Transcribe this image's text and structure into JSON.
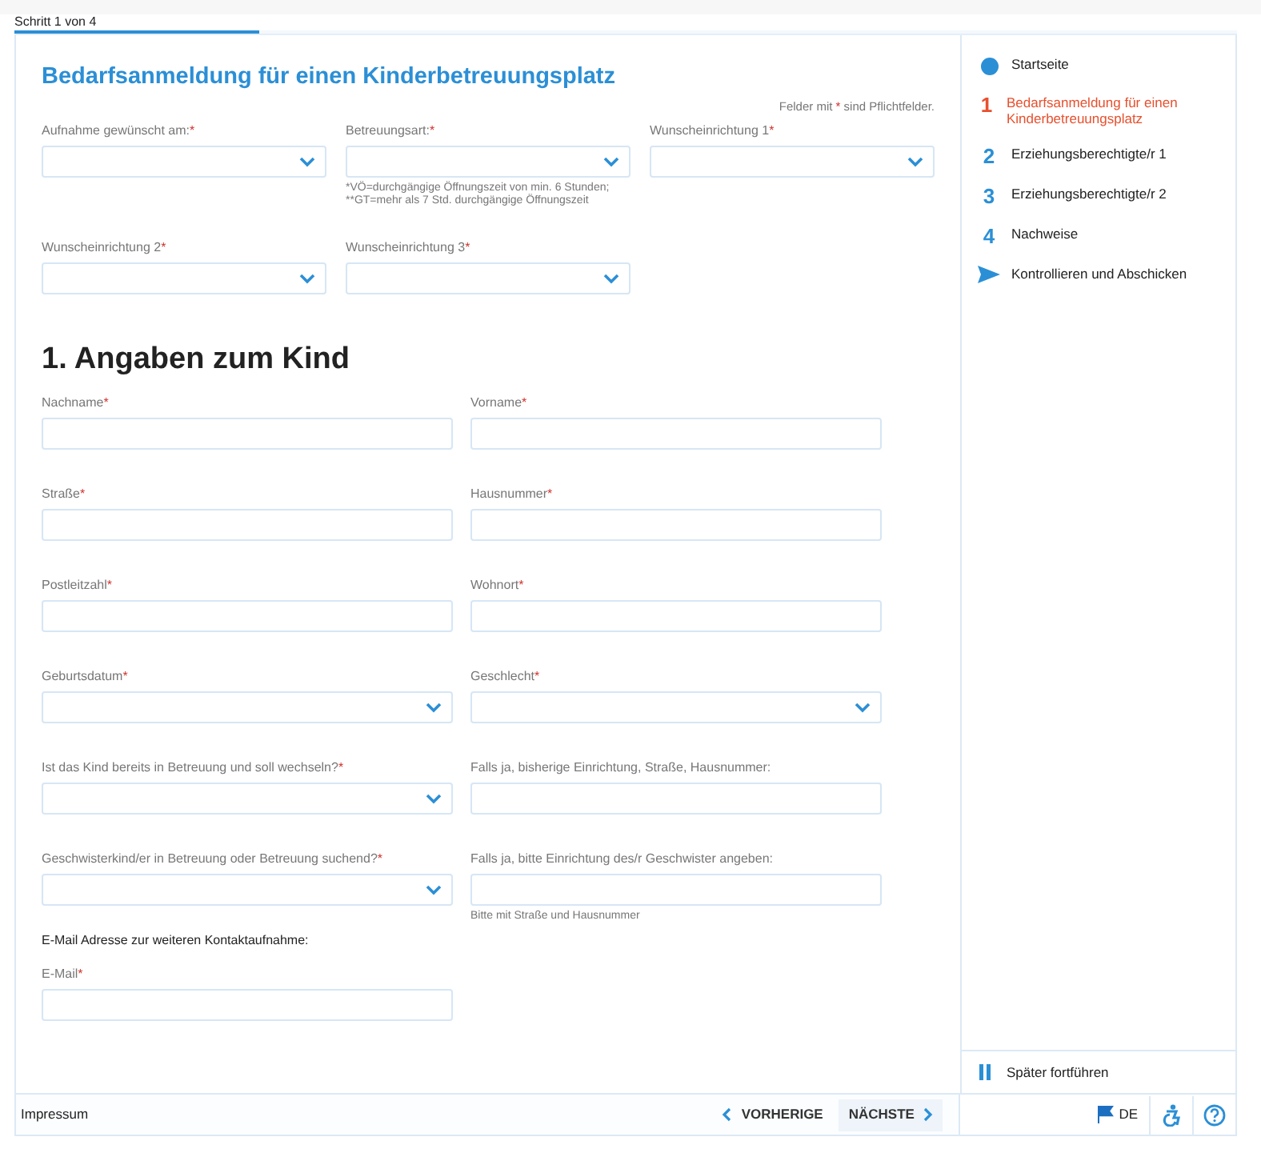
{
  "progress": {
    "label": "Schritt 1 von 4",
    "level": 0.2
  },
  "form_title": "Bedarfsanmeldung für einen Kinderbetreuungsplatz",
  "required_note": {
    "before": "Felder mit ",
    "mark": "*",
    "after": " sind Pflichtfelder."
  },
  "top_fields": [
    {
      "label": "Aufnahme gewünscht am:",
      "mark": "*",
      "kind": "select"
    },
    {
      "label": "Betreuungsart:",
      "mark": "*",
      "kind": "select",
      "hint": "*VÖ=durchgängige Öffnungszeit von min. 6 Stunden;\n**GT=mehr als 7 Std. durchgängige Öffnungszeit"
    },
    {
      "label": "Wunscheinrichtung 1",
      "mark": "*",
      "kind": "select"
    },
    {
      "label": "Wunscheinrichtung 2",
      "mark": "*",
      "kind": "select"
    },
    {
      "label": "Wunscheinrichtung 3",
      "mark": "*",
      "kind": "select"
    }
  ],
  "section_title": "1. Angaben zum Kind",
  "child_fields": [
    {
      "label": "Nachname",
      "mark": "*",
      "kind": "text"
    },
    {
      "label": "Vorname",
      "mark": "*",
      "kind": "text"
    },
    {
      "label": "Straße",
      "mark": "*",
      "kind": "text"
    },
    {
      "label": "Hausnummer",
      "mark": "*",
      "kind": "text"
    },
    {
      "label": "Postleitzahl",
      "mark": "*",
      "kind": "text"
    },
    {
      "label": "Wohnort",
      "mark": "*",
      "kind": "text"
    },
    {
      "label": "Geburtsdatum",
      "mark": "*",
      "kind": "select"
    },
    {
      "label": "Geschlecht",
      "mark": "*",
      "kind": "select"
    },
    {
      "label": "Ist das Kind bereits in Betreuung und soll wechseln?",
      "mark": "*",
      "kind": "select"
    },
    {
      "label": "Falls ja, bisherige Einrichtung, Straße, Hausnummer:",
      "kind": "text"
    },
    {
      "label": "Geschwisterkind/er in Betreuung oder Betreuung suchend?",
      "mark": "*",
      "kind": "select"
    },
    {
      "label": "Falls ja, bitte Einrichtung des/r Geschwister angeben:",
      "kind": "text",
      "hint": "Bitte mit Straße und Hausnummer"
    }
  ],
  "contact_heading": "E-Mail Adresse zur weiteren Kontaktaufnahme:",
  "contact_fields": [
    {
      "label": "E-Mail",
      "mark": "*",
      "kind": "text"
    }
  ],
  "steps": [
    {
      "kind": "dot",
      "label": "Startseite",
      "selected": false
    },
    {
      "kind": "number",
      "number": "1",
      "label": "Bedarfsanmeldung für einen Kinderbetreuungsplatz",
      "selected": true
    },
    {
      "kind": "number",
      "number": "2",
      "label": "Erziehungsberechtigte/r 1",
      "selected": false
    },
    {
      "kind": "number",
      "number": "3",
      "label": "Erziehungsberechtigte/r 2",
      "selected": false
    },
    {
      "kind": "number",
      "number": "4",
      "label": "Nachweise",
      "selected": false
    },
    {
      "kind": "send",
      "label": "Kontrollieren und Abschicken",
      "selected": false
    }
  ],
  "save_later": "Später fortführen",
  "footer": {
    "impressum": "Impressum",
    "previous": "VORHERIGE",
    "next": "NÄCHSTE",
    "language": "DE"
  }
}
